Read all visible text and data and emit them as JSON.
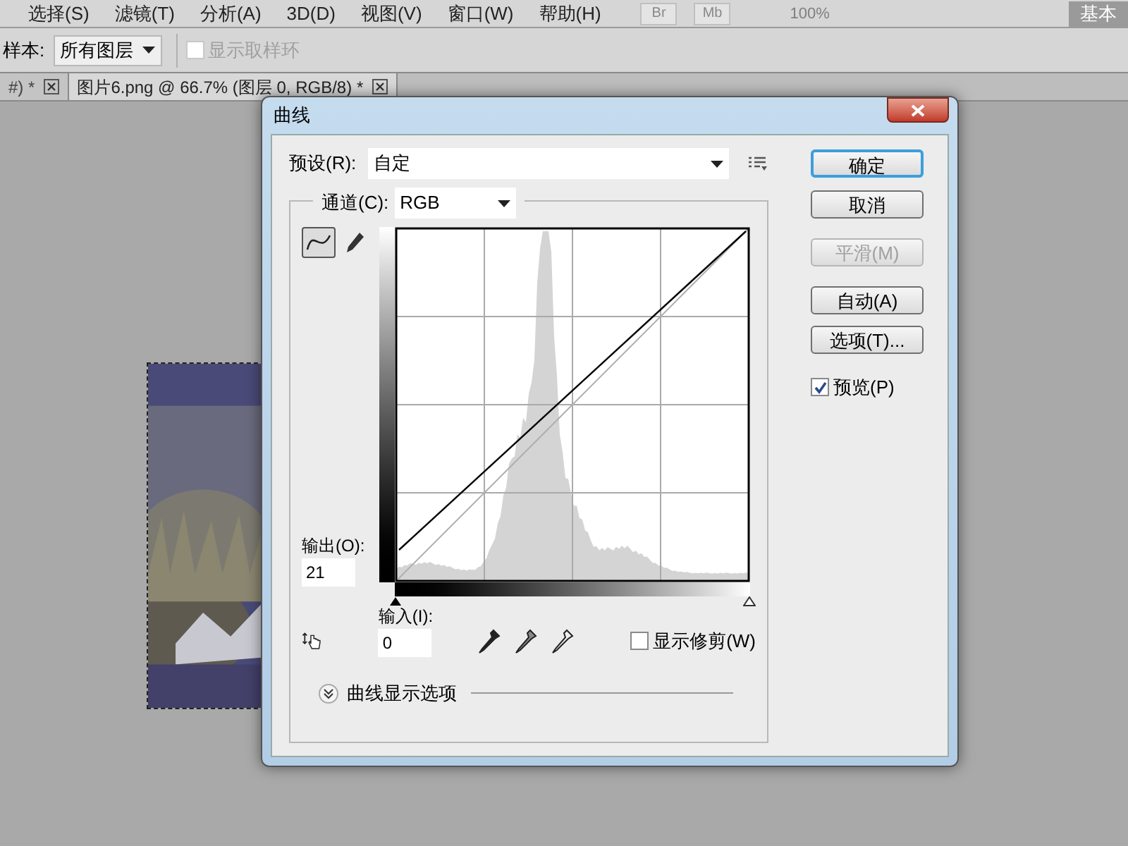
{
  "menu": [
    "选择(S)",
    "滤镜(T)",
    "分析(A)",
    "3D(D)",
    "视图(V)",
    "窗口(W)",
    "帮助(H)"
  ],
  "app_buttons": [
    "Br",
    "Mb"
  ],
  "zoom": "100%",
  "workspace": "基本",
  "options": {
    "sample_label": "样本:",
    "sample_value": "所有图层",
    "ring": {
      "label": "显示取样环",
      "checked": false,
      "disabled": true
    }
  },
  "doc_tabs": [
    {
      "label": "#) *",
      "selected": false
    },
    {
      "label": "图片6.png @ 66.7% (图层 0, RGB/8) *",
      "selected": true
    }
  ],
  "dialog": {
    "title": "曲线",
    "preset": {
      "label": "预设(R):",
      "value": "自定"
    },
    "channel": {
      "label": "通道(C):",
      "value": "RGB"
    },
    "tools": [
      {
        "kind": "curve",
        "selected": true
      },
      {
        "kind": "pencil",
        "selected": false
      }
    ],
    "output": {
      "label": "输出(O):",
      "value": "21"
    },
    "input": {
      "label": "输入(I):",
      "value": "0"
    },
    "shadow_slider": {
      "level": 0
    },
    "highlight_slider": {
      "level": 1
    },
    "show_clipping": {
      "label": "显示修剪(W)",
      "checked": false
    },
    "display_options": "曲线显示选项",
    "buttons": [
      {
        "label": "确定",
        "default": true,
        "disabled": false
      },
      {
        "label": "取消",
        "default": false,
        "disabled": false
      },
      {
        "label": "平滑(M)",
        "default": false,
        "disabled": true
      },
      {
        "label": "自动(A)",
        "default": false,
        "disabled": false
      },
      {
        "label": "选项(T)...",
        "default": false,
        "disabled": false
      }
    ],
    "preview": {
      "label": "预览(P)",
      "checked": true
    }
  }
}
